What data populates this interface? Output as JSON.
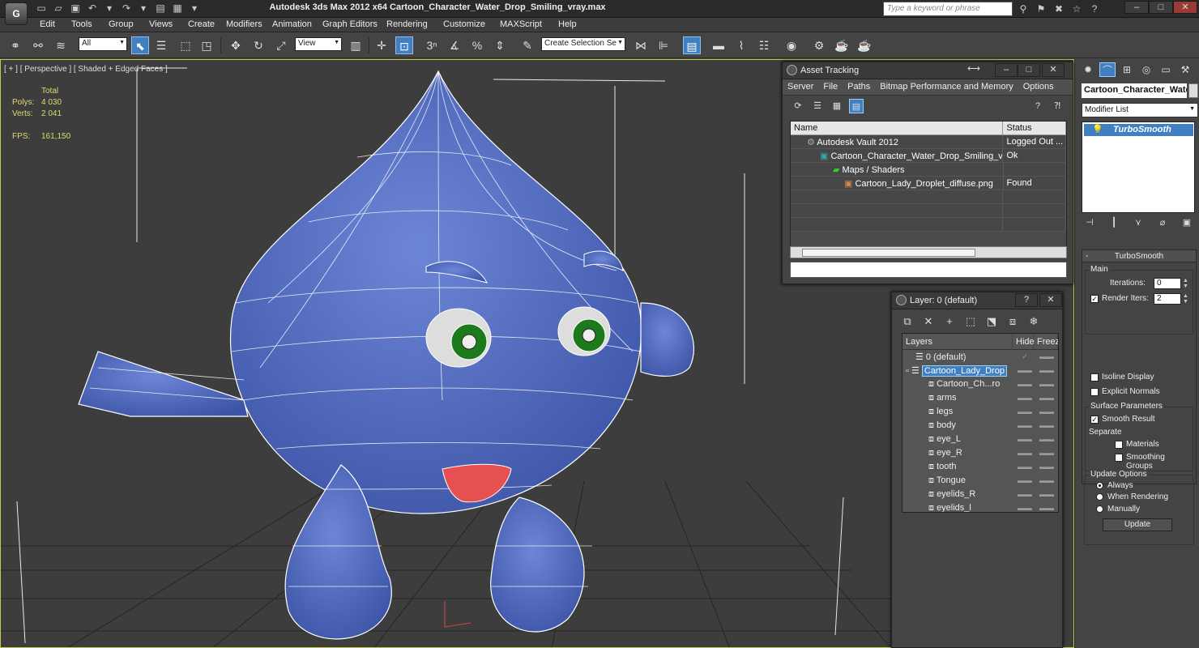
{
  "app": {
    "logo": "G",
    "title": "Autodesk 3ds Max  2012 x64      Cartoon_Character_Water_Drop_Smiling_vray.max",
    "search_placeholder": "Type a keyword or phrase"
  },
  "menu": [
    "Edit",
    "Tools",
    "Group",
    "Views",
    "Create",
    "Modifiers",
    "Animation",
    "Graph Editors",
    "Rendering",
    "Customize",
    "MAXScript",
    "Help"
  ],
  "toolbar": {
    "selection_filter": "All",
    "ref_coord": "View",
    "named_selection": "Create Selection Se",
    "snap_label": "3"
  },
  "viewport": {
    "label": "[ + ] [ Perspective ] [ Shaded + Edged Faces ]",
    "stats_header": "Total",
    "polys_label": "Polys:",
    "polys_value": "4 030",
    "verts_label": "Verts:",
    "verts_value": "2 041",
    "fps_label": "FPS:",
    "fps_value": "161,150"
  },
  "asset_tracking": {
    "title": "Asset Tracking",
    "menu": [
      "Server",
      "File",
      "Paths",
      "Bitmap Performance and Memory",
      "Options"
    ],
    "columns": [
      "Name",
      "Status"
    ],
    "rows": [
      {
        "name": "Autodesk Vault 2012",
        "status": "Logged Out ...",
        "indent": 1
      },
      {
        "name": "Cartoon_Character_Water_Drop_Smiling_vr...",
        "status": "Ok",
        "indent": 2
      },
      {
        "name": "Maps / Shaders",
        "status": "",
        "indent": 3
      },
      {
        "name": "Cartoon_Lady_Droplet_diffuse.png",
        "status": "Found",
        "indent": 4
      }
    ]
  },
  "layer_manager": {
    "title": "Layer: 0 (default)",
    "help": "?",
    "columns": [
      "Layers",
      "Hide",
      "Freez"
    ],
    "layers": [
      {
        "name": "0 (default)",
        "level": 0,
        "check": "✓"
      },
      {
        "name": "Cartoon_Lady_Drop",
        "level": 0,
        "selected": true
      },
      {
        "name": "Cartoon_Ch...ro",
        "level": 1
      },
      {
        "name": "arms",
        "level": 1
      },
      {
        "name": "legs",
        "level": 1
      },
      {
        "name": "body",
        "level": 1
      },
      {
        "name": "eye_L",
        "level": 1
      },
      {
        "name": "eye_R",
        "level": 1
      },
      {
        "name": "tooth",
        "level": 1
      },
      {
        "name": "Tongue",
        "level": 1
      },
      {
        "name": "eyelids_R",
        "level": 1
      },
      {
        "name": "eyelids_l",
        "level": 1
      }
    ],
    "dash": "▬▬"
  },
  "command_panel": {
    "object_name": "Cartoon_Character_Water",
    "modifier_list": "Modifier List",
    "stack_item": "TurboSmooth",
    "rollout": "TurboSmooth",
    "main": "Main",
    "iterations_label": "Iterations:",
    "iterations_value": "0",
    "render_iters_label": "Render Iters:",
    "render_iters_value": "2",
    "isoline": "Isoline Display",
    "explicit": "Explicit Normals",
    "surface_params": "Surface Parameters",
    "smooth_result": "Smooth Result",
    "separate": "Separate",
    "materials": "Materials",
    "smoothing_groups": "Smoothing Groups",
    "update_options": "Update Options",
    "always": "Always",
    "when_rendering": "When Rendering",
    "manually": "Manually",
    "update_btn": "Update"
  }
}
